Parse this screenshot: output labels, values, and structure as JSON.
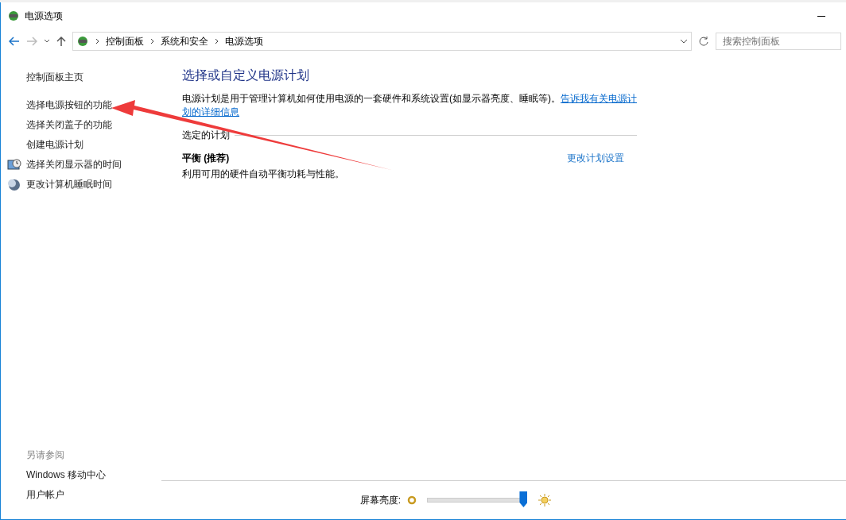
{
  "window": {
    "title": "电源选项"
  },
  "address_bar": {
    "breadcrumbs": [
      "控制面板",
      "系统和安全",
      "电源选项"
    ],
    "search_placeholder": "搜索控制面板"
  },
  "sidebar": {
    "items": [
      {
        "label": "控制面板主页",
        "kind": "home"
      },
      {
        "label": "选择电源按钮的功能",
        "kind": "link"
      },
      {
        "label": "选择关闭盖子的功能",
        "kind": "link"
      },
      {
        "label": "创建电源计划",
        "kind": "link"
      },
      {
        "label": "选择关闭显示器的时间",
        "kind": "monitor"
      },
      {
        "label": "更改计算机睡眠时间",
        "kind": "moon"
      }
    ],
    "see_also": {
      "heading": "另请参阅",
      "items": [
        "Windows 移动中心",
        "用户帐户"
      ]
    }
  },
  "main": {
    "heading": "选择或自定义电源计划",
    "description": "电源计划是用于管理计算机如何使用电源的一套硬件和系统设置(如显示器亮度、睡眠等)。",
    "link": [
      "告诉我有关电源计",
      "划的详细信息"
    ],
    "section": "选定的计划",
    "plans": [
      {
        "name": "平衡 (推荐)",
        "description": "利用可用的硬件自动平衡功耗与性能。",
        "action": "更改计划设置"
      }
    ]
  },
  "brightness": {
    "label": "屏幕亮度:",
    "level": 0.97
  }
}
